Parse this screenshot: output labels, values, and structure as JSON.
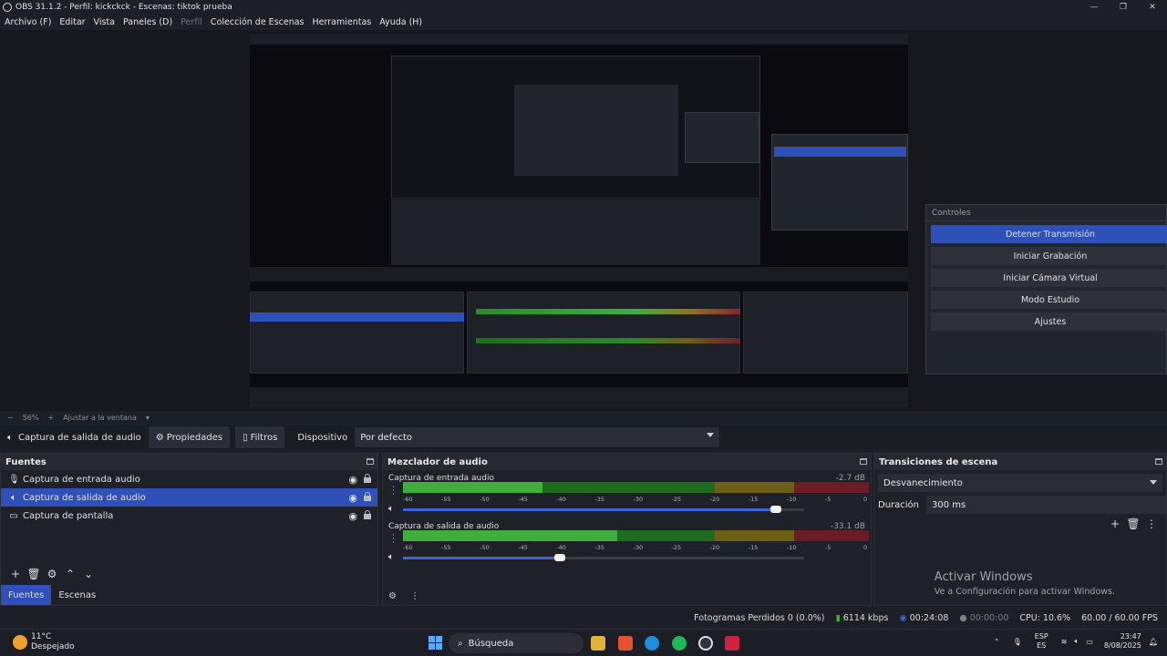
{
  "window": {
    "title": "OBS 31.1.2 - Perfil: kickckck - Escenas: tiktok prueba",
    "minimize": "—",
    "maximize": "❐",
    "close": "✕"
  },
  "menu": [
    {
      "label": "Archivo (F)",
      "disabled": false
    },
    {
      "label": "Editar",
      "disabled": false
    },
    {
      "label": "Vista",
      "disabled": false
    },
    {
      "label": "Paneles (D)",
      "disabled": false
    },
    {
      "label": "Perfil",
      "disabled": true
    },
    {
      "label": "Colección de Escenas",
      "disabled": false
    },
    {
      "label": "Herramientas",
      "disabled": false
    },
    {
      "label": "Ayuda (H)",
      "disabled": false
    }
  ],
  "controls": {
    "title": "Controles",
    "buttons": [
      "Detener Transmisión",
      "Iniciar Grabación",
      "Iniciar Cámara Virtual",
      "Modo Estudio",
      "Ajustes"
    ]
  },
  "zoom": {
    "minus": "−",
    "level": "56%",
    "plus": "+",
    "fit": "Ajustar a la ventana"
  },
  "source_toolbar": {
    "source_name": "Captura de salida de audio",
    "properties": "Propiedades",
    "filters": "Filtros",
    "device_label": "Dispositivo",
    "device_value": "Por defecto"
  },
  "sources": {
    "title": "Fuentes",
    "items": [
      {
        "label": "Captura de entrada audio",
        "icon": "mic-icon",
        "selected": false
      },
      {
        "label": "Captura de salida de audio",
        "icon": "speaker-icon",
        "selected": true
      },
      {
        "label": "Captura de pantalla",
        "icon": "monitor-icon",
        "selected": false
      }
    ],
    "tabs": [
      "Fuentes",
      "Escenas"
    ]
  },
  "mixer": {
    "title": "Mezclador de audio",
    "ticks": [
      "-60",
      "-55",
      "-50",
      "-45",
      "-40",
      "-35",
      "-30",
      "-25",
      "-20",
      "-15",
      "-10",
      "-5",
      "0"
    ],
    "channels": [
      {
        "name": "Captura de entrada audio",
        "db": "-2.7 dB",
        "volume": 0.93,
        "level": 0.3
      },
      {
        "name": "Captura de salida de audio",
        "db": "-33.1 dB",
        "volume": 0.39,
        "level": 0.46
      }
    ]
  },
  "transitions": {
    "title": "Transiciones de escena",
    "type": "Desvanecimiento",
    "duration_label": "Duración",
    "duration_value": "300 ms",
    "activate_line1": "Activar Windows",
    "activate_line2": "Ve a Configuración para activar Windows."
  },
  "status": {
    "dropped": "Fotogramas Perdidos 0 (0.0%)",
    "bitrate": "6114 kbps",
    "stream_time": "00:24:08",
    "rec_time": "00:00:00",
    "cpu": "CPU: 10.6%",
    "fps": "60.00 / 60.00 FPS"
  },
  "taskbar": {
    "temp": "11°C",
    "weather": "Despejado",
    "search": "Búsqueda",
    "lang1": "ESP",
    "lang2": "ES",
    "time": "23:47",
    "date": "8/08/2025"
  },
  "colors": {
    "accent": "#2f50b8",
    "bg": "#1d1f26",
    "green": "#3fae3f",
    "yellow": "#b89a1e",
    "red": "#b02a36"
  }
}
